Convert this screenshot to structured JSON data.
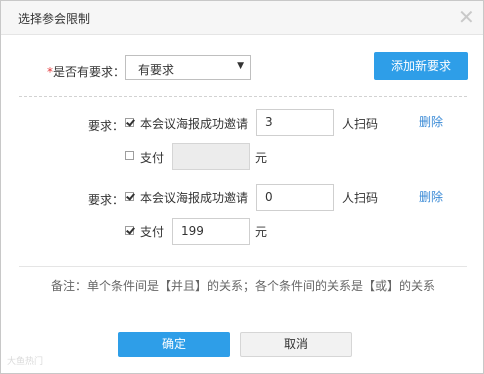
{
  "dialog": {
    "title": "选择参会限制",
    "close_glyph": "✕"
  },
  "has_requirement": {
    "required_mark": "*",
    "label": "是否有要求：",
    "selected": "有要求",
    "arrow_glyph": "▼"
  },
  "add_button_label": "添加新要求",
  "requirements": [
    {
      "label": "要求：",
      "invite": {
        "checked": true,
        "label": "本会议海报成功邀请",
        "value": "3",
        "unit": "人扫码"
      },
      "pay": {
        "checked": false,
        "label": "支付",
        "value": "",
        "unit": "元",
        "disabled": true
      },
      "delete_label": "删除"
    },
    {
      "label": "要求：",
      "invite": {
        "checked": true,
        "label": "本会议海报成功邀请",
        "value": "0",
        "unit": "人扫码"
      },
      "pay": {
        "checked": true,
        "label": "支付",
        "value": "199",
        "unit": "元",
        "disabled": false
      },
      "delete_label": "删除"
    }
  ],
  "note": "备注：单个条件间是【并且】的关系；各个条件间的关系是【或】的关系",
  "footer": {
    "ok_label": "确定",
    "cancel_label": "取消"
  },
  "watermark": "大鱼热门",
  "colors": {
    "primary": "#2e9ee8",
    "link": "#3a8ad6",
    "required": "#e4393c"
  }
}
